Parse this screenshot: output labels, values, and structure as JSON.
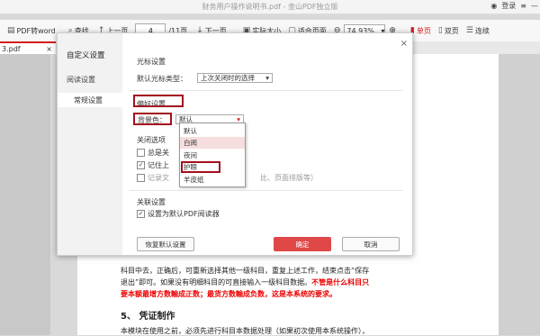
{
  "window": {
    "title": "财务用户操作说明书.pdf - 金山PDF独立版",
    "login_label": "登录"
  },
  "toolbar": {
    "pdf2word_label": "PDF转word",
    "find_label": "查找",
    "prev_label": "上一页",
    "page_value": "4",
    "page_total": "/11页",
    "next_label": "下一页",
    "actual_size_label": "实际大小",
    "fit_page_label": "适合页面",
    "zoom_value": "74.93%",
    "single_page_label": "单页",
    "double_page_label": "双页",
    "continuous_label": "连续"
  },
  "tab": {
    "label": "3.pdf"
  },
  "dialog": {
    "close": "×",
    "nav_title": "自定义设置",
    "nav_items": [
      "阅读设置",
      "常规设置"
    ],
    "cursor_section_title": "光标设置",
    "cursor_label": "默认光标类型：",
    "cursor_value": "上次关闭时的选择",
    "pref_section_title": "偏好设置",
    "bg_label": "背景色：",
    "bg_value": "默认",
    "close_section_title": "关闭选项",
    "check1_label": "总是关",
    "check2_label": "记住上",
    "check3_label": "记录文",
    "check3_suffix": "比、页面排版等）",
    "bg_options": [
      "默认",
      "白阅",
      "夜间",
      "护眼",
      "羊皮纸"
    ],
    "assoc_section_title": "关联设置",
    "assoc_check_label": "设置为默认PDF阅读器",
    "reset_button": "恢复默认设置",
    "ok_button": "确定",
    "cancel_button": "取消"
  },
  "document": {
    "line1": "科目中去，正确后，可重新选择其他一级科目，重复上述工作，结束点击“保存",
    "line2": "退出”即可。如果没有明细科目的可直接输入一级科目数据。",
    "line2_red": "不管是什么科目只",
    "line3_red": "要本额最增方数輸成正数；最货方数輸成负数，这是本系统的要求。",
    "heading": "5、 凭证制作",
    "line4": "本模块在使用之前，必须先进行科目本数据处理（如果初次使用本系统操作），"
  },
  "colors": {
    "accent": "#d21f1f",
    "primary_button": "#e04848",
    "highlight_box": "#a3101e",
    "option_highlight": "#f6dede"
  }
}
